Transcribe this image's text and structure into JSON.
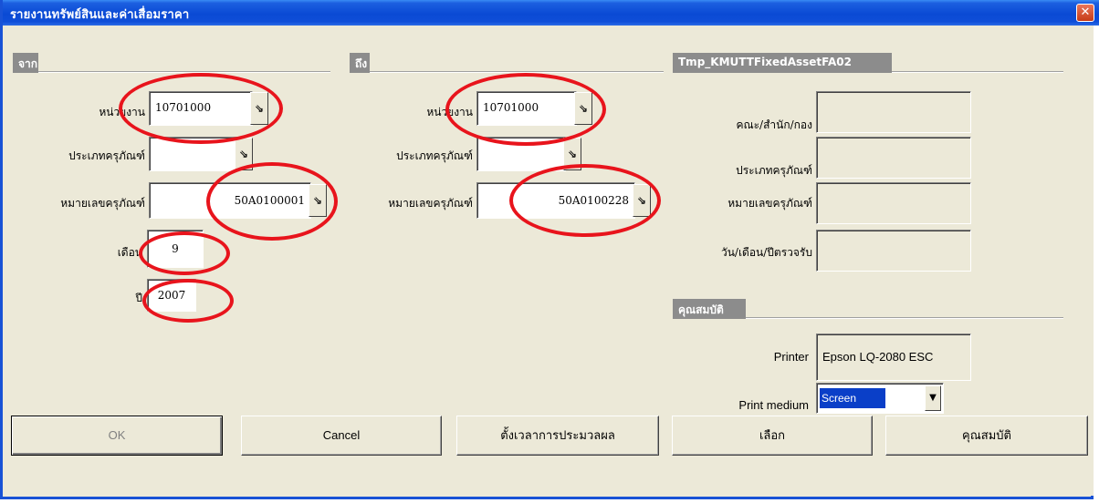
{
  "window": {
    "title": "รายงานทรัพย์สินและค่าเสื่อมราคา",
    "close_glyph": "✕"
  },
  "from_group": {
    "header": "จาก",
    "unit_label": "หน่วยงาน",
    "unit_value": "10701000",
    "asset_type_label": "ประเภทครุภัณฑ์",
    "asset_type_value": "",
    "asset_number_label": "หมายเลขครุภัณฑ์",
    "asset_number_value": "50A0100001",
    "month_label": "เดือน",
    "month_value": "9",
    "year_label": "ปี",
    "year_value": "2007"
  },
  "to_group": {
    "header": "ถึง",
    "unit_label": "หน่วยงาน",
    "unit_value": "10701000",
    "asset_type_label": "ประเภทครุภัณฑ์",
    "asset_type_value": "",
    "asset_number_label": "หมายเลขครุภัณฑ์",
    "asset_number_value": "50A0100228"
  },
  "info_group": {
    "header": "Tmp_KMUTTFixedAssetFA02",
    "faculty_label": "คณะ/สำนัก/กอง",
    "asset_type_label": "ประเภทครุภัณฑ์",
    "asset_number_label": "หมายเลขครุภัณฑ์",
    "receive_date_label": "วัน/เดือน/ปีตรวจรับ"
  },
  "properties_group": {
    "header": "คุณสมบัติ",
    "printer_label": "Printer",
    "printer_value": "Epson LQ-2080 ESC",
    "print_medium_label": "Print medium",
    "print_medium_value": "Screen"
  },
  "lookup_glyph": "⇘",
  "dropdown_glyph": "▼",
  "buttons": {
    "ok": "OK",
    "cancel": "Cancel",
    "schedule": "ตั้งเวลาการประมวลผล",
    "select": "เลือก",
    "properties": "คุณสมบัติ"
  },
  "annotation_color": "#e8141c"
}
